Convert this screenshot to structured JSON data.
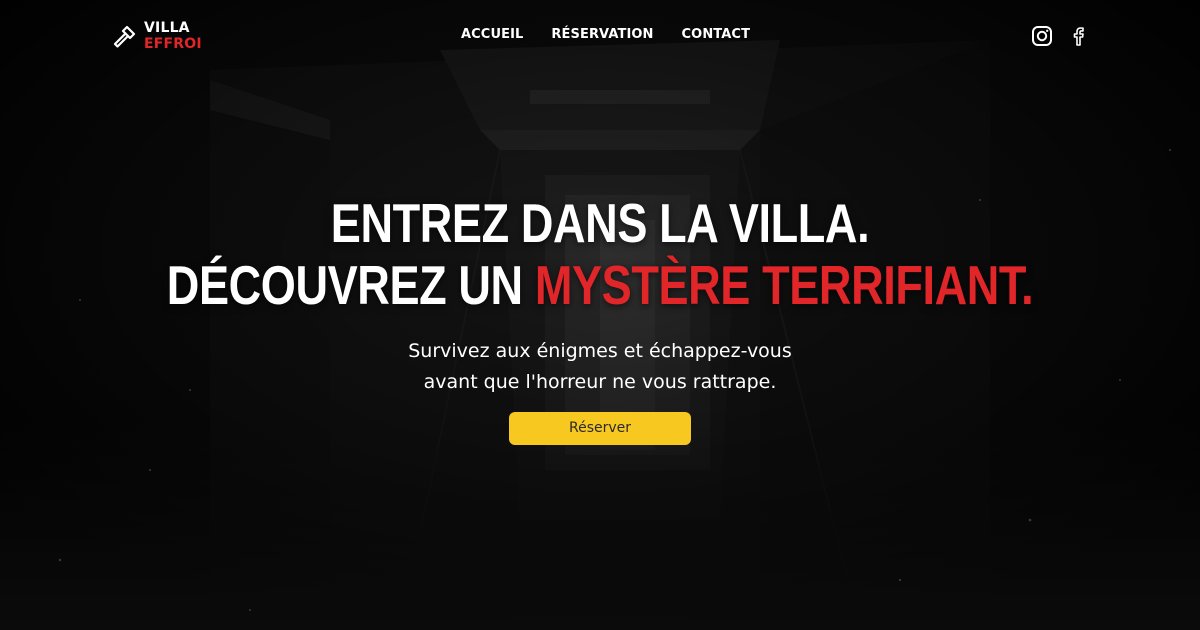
{
  "brand": {
    "line1": "VILLA",
    "line2": "EFFROI"
  },
  "nav": {
    "items": [
      {
        "label": "ACCUEIL"
      },
      {
        "label": "RÉSERVATION"
      },
      {
        "label": "CONTACT"
      }
    ]
  },
  "socials": {
    "icons": [
      "instagram-icon",
      "facebook-icon"
    ]
  },
  "hero": {
    "title_line1": "ENTREZ DANS LA VILLA.",
    "title_line2_start": "DÉCOUVREZ UN ",
    "title_line2_accent": "MYSTÈRE TERRIFIANT.",
    "subtitle_line1": "Survivez aux énigmes et échappez-vous",
    "subtitle_line2": "avant que l'horreur ne vous rattrape.",
    "cta_label": "Réserver"
  },
  "colors": {
    "background": "#0b0b0b",
    "accent_red": "#e1262a",
    "cta_yellow": "#f7c820",
    "text": "#ffffff"
  }
}
